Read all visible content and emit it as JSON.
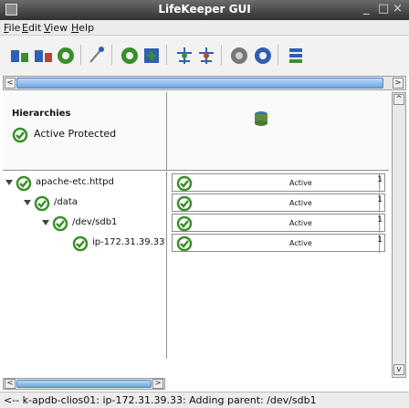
{
  "window": {
    "title": "LifeKeeper GUI",
    "app_icon": "lifekeeper-app-icon"
  },
  "window_controls": {
    "minimize": "_",
    "maximize": "□",
    "close": "×"
  },
  "menu": {
    "file": {
      "label": "File",
      "underline": "F",
      "rest": "ile"
    },
    "edit": {
      "label": "Edit",
      "underline": "E",
      "rest": "dit"
    },
    "view": {
      "label": "View",
      "underline": "V",
      "rest": "iew"
    },
    "help": {
      "label": "Help",
      "underline": "H",
      "rest": "elp"
    }
  },
  "toolbar": {
    "icons": [
      "connect-server-icon",
      "disconnect-server-icon",
      "refresh-icon",
      "wizard-icon",
      "server-properties-icon",
      "create-resource-icon",
      "extend-resource-icon",
      "unextend-resource-icon",
      "in-service-icon",
      "out-of-service-icon",
      "server-list-icon"
    ],
    "colors": {
      "green": "#3a8f2a",
      "blue": "#2f5fb3",
      "gray": "#777777"
    }
  },
  "hierarchies_panel": {
    "heading": "Hierarchies",
    "status_label": "Active Protected"
  },
  "server_column": {
    "icon": "server-database-icon"
  },
  "tree": [
    {
      "label": "apache-etc.httpd",
      "status_icon": "active-check-icon"
    },
    {
      "label": "/data",
      "status_icon": "active-check-icon"
    },
    {
      "label": "/dev/sdb1",
      "status_icon": "active-check-icon"
    },
    {
      "label": "ip-172.31.39.33",
      "status_icon": "active-check-icon"
    }
  ],
  "status_rows": [
    {
      "state": "Active",
      "priority": "1"
    },
    {
      "state": "Active",
      "priority": "1"
    },
    {
      "state": "Active",
      "priority": "1"
    },
    {
      "state": "Active",
      "priority": "1"
    }
  ],
  "status_bar": {
    "message": "<-- k-apdb-clios01: ip-172.31.39.33: Adding parent: /dev/sdb1"
  },
  "scroll_arrows": {
    "left": "<",
    "right": ">",
    "up": "^",
    "down": "v"
  }
}
